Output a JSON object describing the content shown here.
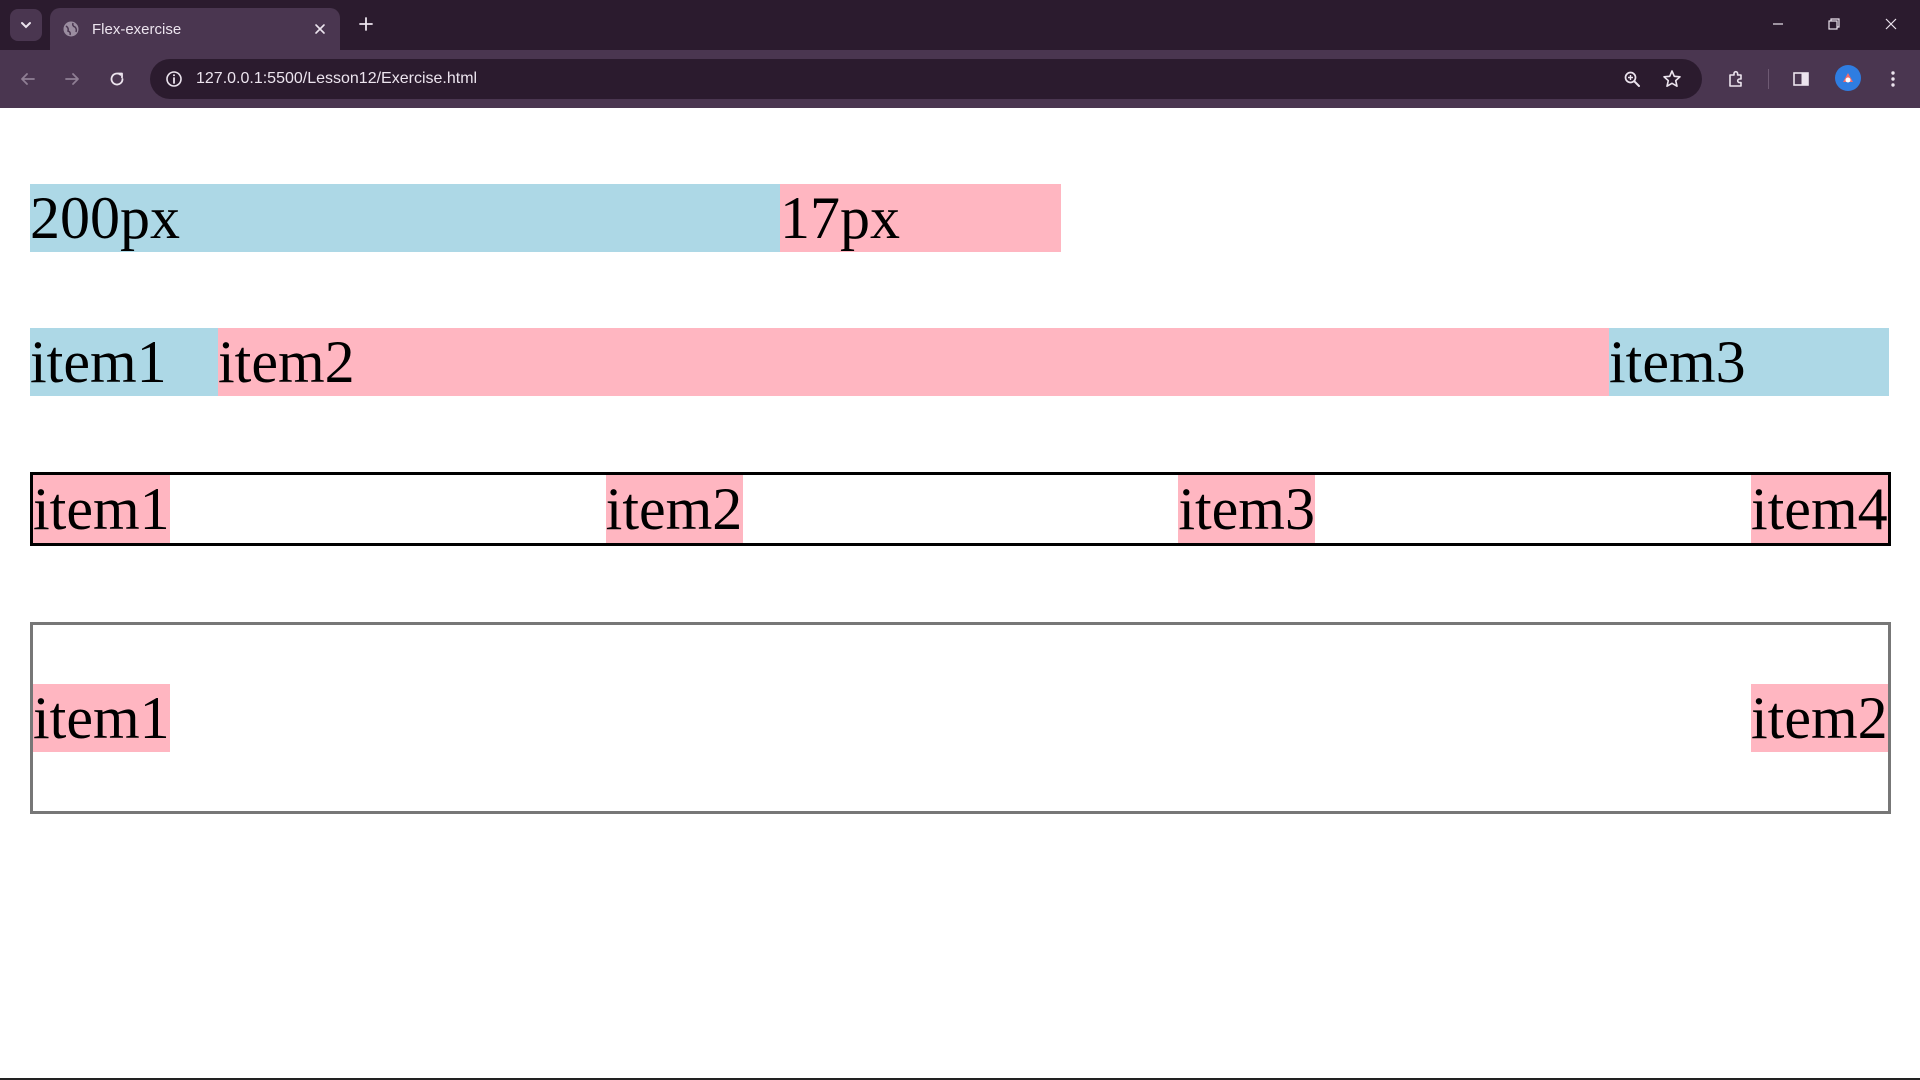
{
  "browser": {
    "tab_title": "Flex-exercise",
    "url": "127.0.0.1:5500/Lesson12/Exercise.html",
    "icons": {
      "tab_search": "chevron-down-icon",
      "favicon": "globe-icon",
      "tab_close": "close-icon",
      "new_tab": "plus-icon",
      "back": "back-arrow-icon",
      "forward": "forward-arrow-icon",
      "reload": "reload-icon",
      "site_info": "info-icon",
      "zoom": "zoom-icon",
      "bookmark": "star-icon",
      "extensions": "puzzle-icon",
      "side_panel": "side-panel-icon",
      "menu": "kebab-menu-icon"
    }
  },
  "page": {
    "row1": {
      "item1": "200px",
      "item2": "17px"
    },
    "row2": {
      "item1": "item1",
      "item2": "item2",
      "item3": "item3"
    },
    "row3": {
      "item1": "item1",
      "item2": "item2",
      "item3": "item3",
      "item4": "item4"
    },
    "row4": {
      "item1": "item1",
      "item2": "item2"
    }
  },
  "colors": {
    "light_blue": "#add8e6",
    "light_pink": "#ffb6c1",
    "titlebar": "#2b1b2e",
    "toolbar": "#4a3650"
  }
}
